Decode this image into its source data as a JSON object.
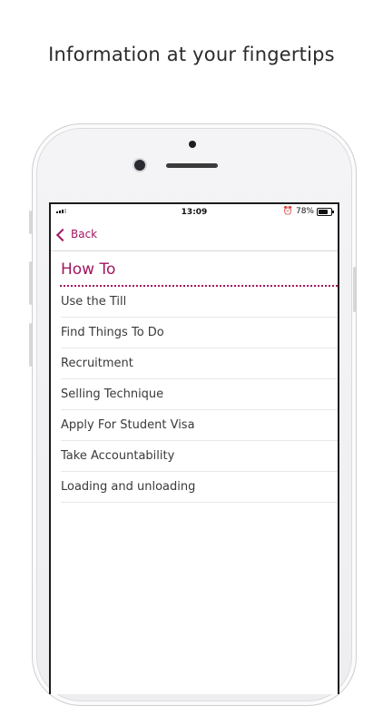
{
  "headline": "Information at your fingertips",
  "status_bar": {
    "time": "13:09",
    "battery": "78%",
    "battery_level": 0.78,
    "alarm_icon": "alarm-clock-icon"
  },
  "nav": {
    "back_label": "Back",
    "back_icon": "chevron-left-icon"
  },
  "section": {
    "title": "How To"
  },
  "items": [
    {
      "label": "Use the Till"
    },
    {
      "label": "Find Things To Do"
    },
    {
      "label": "Recruitment"
    },
    {
      "label": "Selling Technique"
    },
    {
      "label": "Apply For Student Visa"
    },
    {
      "label": "Take Accountability"
    },
    {
      "label": "Loading and unloading"
    }
  ],
  "colors": {
    "accent": "#a3155f",
    "text": "#3a3a3a"
  }
}
